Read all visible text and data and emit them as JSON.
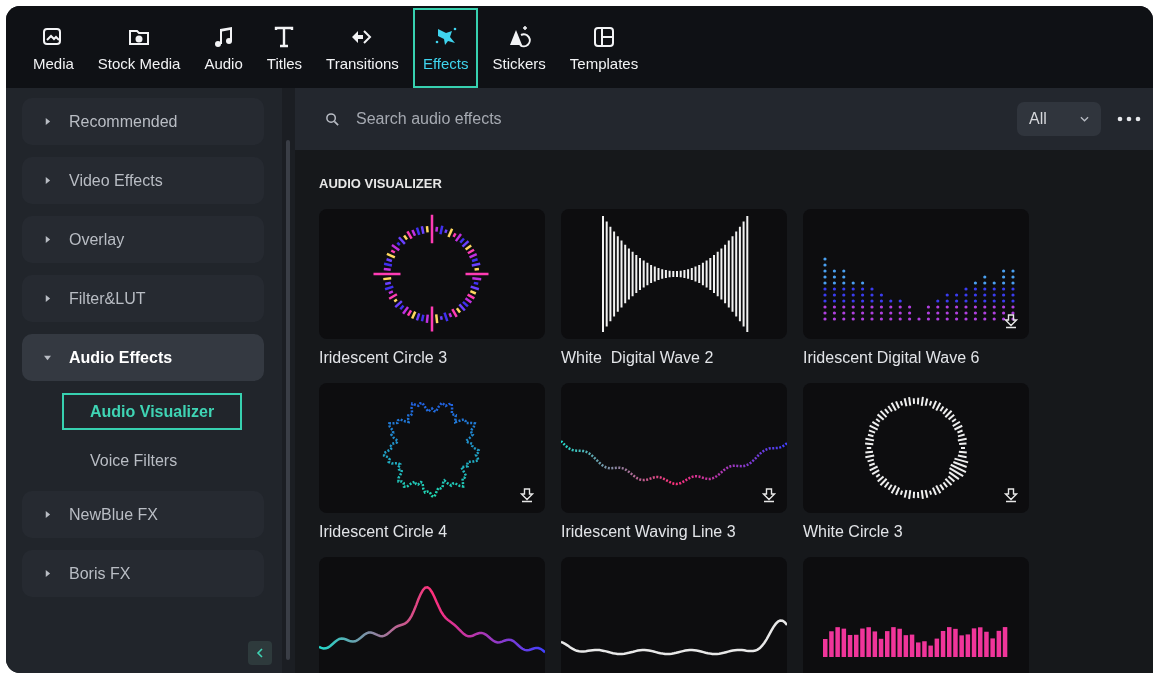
{
  "toolbar": {
    "tabs": [
      {
        "label": "Media",
        "selected": false
      },
      {
        "label": "Stock Media",
        "selected": false
      },
      {
        "label": "Audio",
        "selected": false
      },
      {
        "label": "Titles",
        "selected": false
      },
      {
        "label": "Transitions",
        "selected": false
      },
      {
        "label": "Effects",
        "selected": true
      },
      {
        "label": "Stickers",
        "selected": false
      },
      {
        "label": "Templates",
        "selected": false
      }
    ]
  },
  "sidebar": {
    "items": [
      {
        "label": "Recommended",
        "expanded": false
      },
      {
        "label": "Video Effects",
        "expanded": false
      },
      {
        "label": "Overlay",
        "expanded": false
      },
      {
        "label": "Filter&LUT",
        "expanded": false
      },
      {
        "label": "Audio Effects",
        "expanded": true,
        "children": [
          {
            "label": "Audio Visualizer",
            "selected": true
          },
          {
            "label": "Voice Filters",
            "selected": false
          }
        ]
      },
      {
        "label": "NewBlue FX",
        "expanded": false
      },
      {
        "label": "Boris FX",
        "expanded": false
      }
    ]
  },
  "search": {
    "placeholder": "Search audio effects"
  },
  "filter": {
    "value": "All"
  },
  "section_title": "AUDIO VISUALIZER",
  "cards": [
    {
      "name": "Iridescent Circle 3",
      "kind": "spiky-ring",
      "downloadable": false
    },
    {
      "name": "White  Digital Wave 2",
      "kind": "mirrored-bars",
      "downloadable": false
    },
    {
      "name": "Iridescent Digital Wave 6",
      "kind": "dot-columns",
      "downloadable": true
    },
    {
      "name": "Iridescent Circle 4",
      "kind": "dotted-ring",
      "downloadable": true
    },
    {
      "name": "Iridescent Waving Line 3",
      "kind": "dotted-wave",
      "downloadable": true
    },
    {
      "name": "White Circle 3",
      "kind": "tick-ring",
      "downloadable": true
    },
    {
      "kind": "peak-wave",
      "downloadable": false
    },
    {
      "kind": "valley-line",
      "downloadable": false
    },
    {
      "kind": "bar-columns",
      "downloadable": false
    }
  ]
}
